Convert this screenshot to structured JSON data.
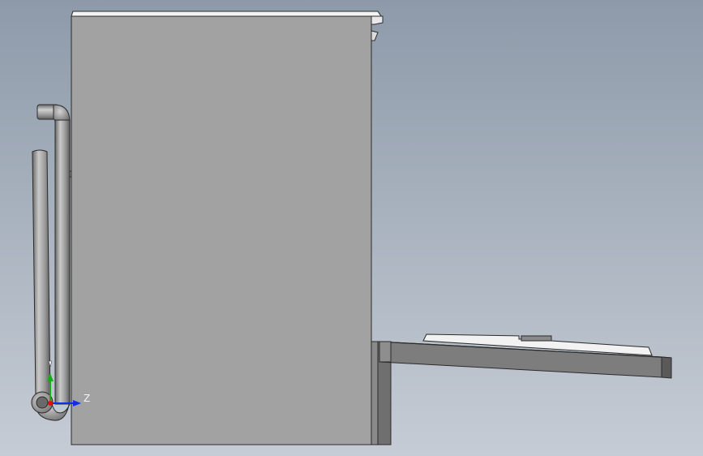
{
  "viewport": {
    "background_top": "#8e9aaa",
    "background_bottom": "#c6ccd5"
  },
  "colors": {
    "body_face": "#a2a2a2",
    "edge": "#2b2b2b",
    "top_cover": "#f4f4f4",
    "base_dark": "#6f6f6f",
    "pipe": "#8e8e8e",
    "pipe_highlight": "#c9c9c9",
    "tray_face": "#7d7d7d",
    "tray_top": "#f2f2f2",
    "axis_x": "#e01010",
    "axis_y": "#10b010",
    "axis_z": "#1030e0"
  },
  "triad": {
    "z_label": "Z",
    "icon": "coordinate-triad-icon"
  }
}
